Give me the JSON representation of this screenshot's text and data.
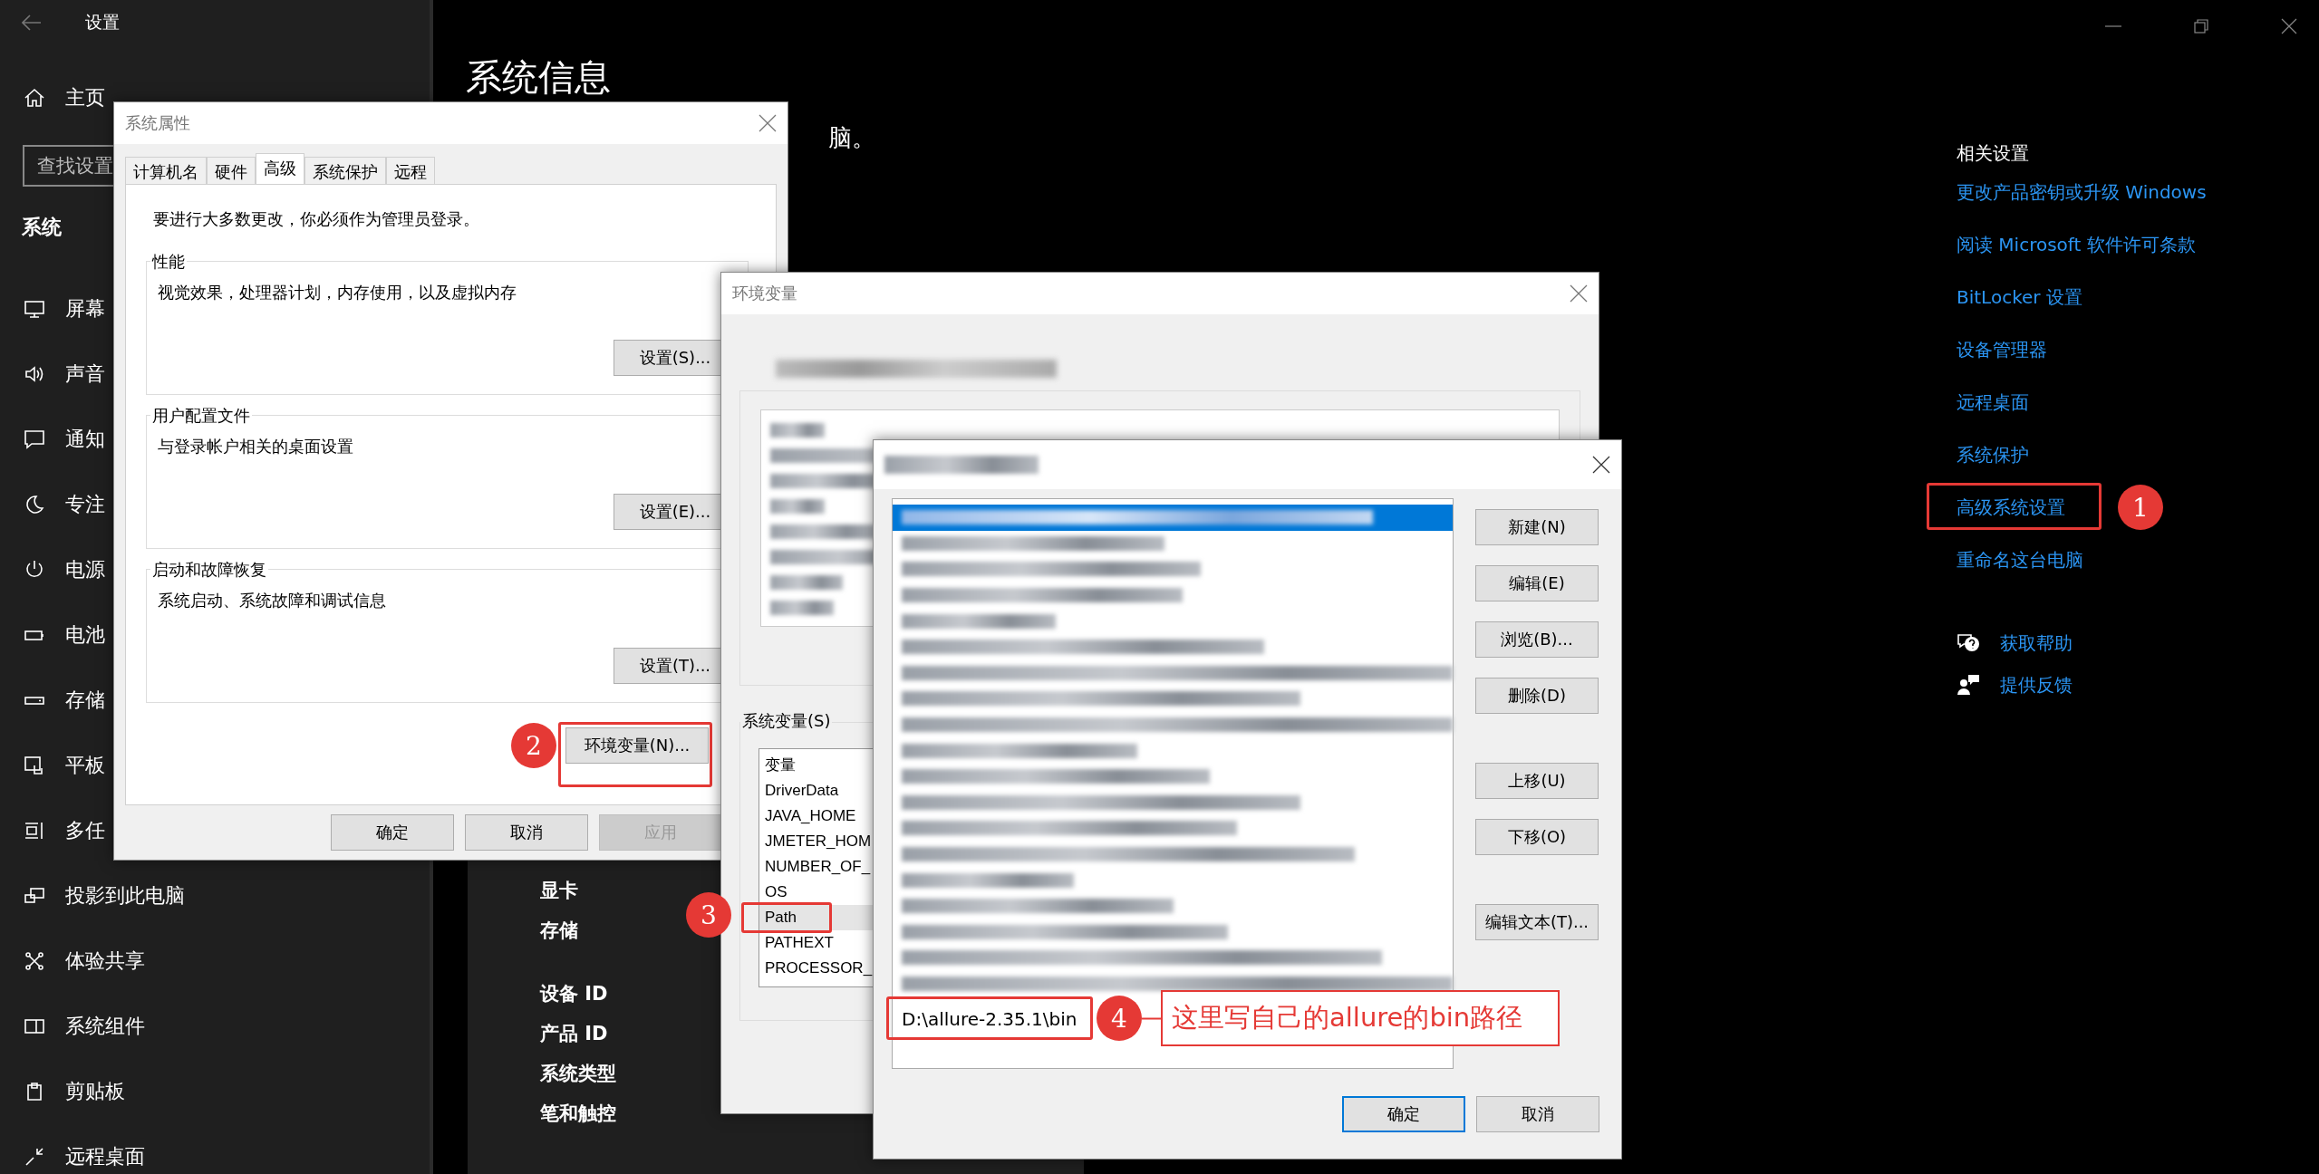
{
  "settings_window": {
    "title": "设置",
    "home": "主页",
    "search": {
      "placeholder": "查找设置"
    },
    "section": "系统",
    "nav": [
      "屏幕",
      "声音",
      "通知",
      "专注",
      "电源",
      "电池",
      "存储",
      "平板",
      "多任",
      "投影到此电脑",
      "体验共享",
      "系统组件",
      "剪贴板",
      "远程桌面"
    ],
    "page_title": "系统信息",
    "page_fragment": "脑。",
    "specs": [
      "显卡",
      "存储",
      "设备 ID",
      "产品 ID",
      "系统类型",
      "笔和触控"
    ],
    "related_title": "相关设置",
    "related_links": [
      {
        "label": "更改产品密钥或升级 Windows",
        "selected": false
      },
      {
        "label": "阅读 Microsoft 软件许可条款",
        "selected": false
      },
      {
        "label": "BitLocker 设置",
        "selected": false
      },
      {
        "label": "设备管理器",
        "selected": false
      },
      {
        "label": "远程桌面",
        "selected": false
      },
      {
        "label": "系统保护",
        "selected": false
      },
      {
        "label": "高级系统设置",
        "selected": true
      },
      {
        "label": "重命名这台电脑",
        "selected": false
      }
    ],
    "help_links": [
      "获取帮助",
      "提供反馈"
    ]
  },
  "system_properties": {
    "title": "系统属性",
    "tabs": [
      {
        "label": "计算机名",
        "selected": false
      },
      {
        "label": "硬件",
        "selected": false
      },
      {
        "label": "高级",
        "selected": true
      },
      {
        "label": "系统保护",
        "selected": false
      },
      {
        "label": "远程",
        "selected": false
      }
    ],
    "notice": "要进行大多数更改，你必须作为管理员登录。",
    "groups": [
      {
        "legend": "性能",
        "text": "视觉效果，处理器计划，内存使用，以及虚拟内存",
        "button": "设置(S)..."
      },
      {
        "legend": "用户配置文件",
        "text": "与登录帐户相关的桌面设置",
        "button": "设置(E)..."
      },
      {
        "legend": "启动和故障恢复",
        "text": "系统启动、系统故障和调试信息",
        "button": "设置(T)..."
      }
    ],
    "env_button": "环境变量(N)...",
    "buttons": [
      {
        "label": "确定",
        "disabled": false
      },
      {
        "label": "取消",
        "disabled": false
      },
      {
        "label": "应用",
        "disabled": true
      }
    ]
  },
  "environment_variables": {
    "title": "环境变量",
    "system_label": "系统变量(S)",
    "system_rows": [
      {
        "name": "变量",
        "selected": false
      },
      {
        "name": "DriverData",
        "selected": false
      },
      {
        "name": "JAVA_HOME",
        "selected": false
      },
      {
        "name": "JMETER_HOM",
        "selected": false
      },
      {
        "name": "NUMBER_OF_",
        "selected": false
      },
      {
        "name": "OS",
        "selected": false
      },
      {
        "name": "Path",
        "selected": true
      },
      {
        "name": "PATHEXT",
        "selected": false
      },
      {
        "name": "PROCESSOR_",
        "selected": false
      }
    ]
  },
  "edit_variable": {
    "entries": [
      {
        "kind": "blurred",
        "selected": true
      },
      {
        "kind": "blurred",
        "selected": false
      },
      {
        "kind": "blurred",
        "selected": false
      },
      {
        "kind": "blurred",
        "selected": false
      },
      {
        "kind": "blurred",
        "selected": false
      },
      {
        "kind": "blurred",
        "selected": false
      },
      {
        "kind": "blurred",
        "selected": false
      },
      {
        "kind": "blurred",
        "selected": false
      },
      {
        "kind": "blurred",
        "selected": false
      },
      {
        "kind": "blurred",
        "selected": false
      },
      {
        "kind": "blurred",
        "selected": false
      },
      {
        "kind": "blurred",
        "selected": false
      },
      {
        "kind": "blurred",
        "selected": false
      },
      {
        "kind": "blurred",
        "selected": false
      },
      {
        "kind": "blurred",
        "selected": false
      },
      {
        "kind": "blurred",
        "selected": false
      },
      {
        "kind": "blurred",
        "selected": false
      },
      {
        "kind": "blurred",
        "selected": false
      },
      {
        "kind": "blurred",
        "selected": false
      },
      {
        "kind": "text",
        "text": "D:\\allure-2.35.1\\bin",
        "selected": false
      }
    ],
    "side_buttons": [
      "新建(N)",
      "编辑(E)",
      "浏览(B)...",
      "删除(D)",
      "上移(U)",
      "下移(O)",
      "编辑文本(T)..."
    ],
    "ok": "确定",
    "cancel": "取消"
  },
  "annotations": {
    "badges": [
      "1",
      "2",
      "3",
      "4"
    ],
    "callout": "这里写自己的allure的bin路径"
  }
}
